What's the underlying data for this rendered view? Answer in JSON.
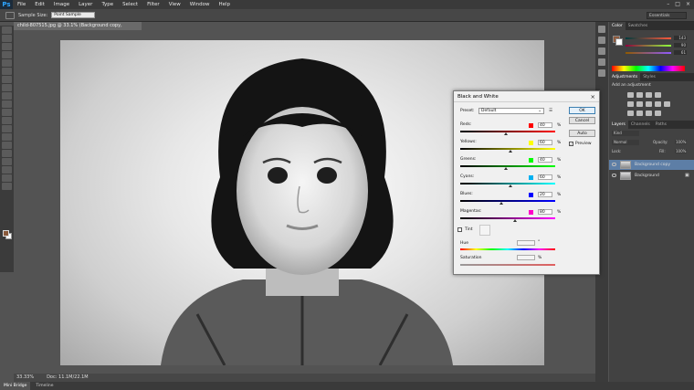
{
  "app": {
    "logo": "Ps"
  },
  "menu": {
    "items": [
      "File",
      "Edit",
      "Image",
      "Layer",
      "Type",
      "Select",
      "Filter",
      "View",
      "Window",
      "Help"
    ]
  },
  "options": {
    "sample_size_label": "Sample Size:",
    "sample_size_value": "Point Sample",
    "workspace": "Essentials"
  },
  "document": {
    "tab_title": "child-807515.jpg @ 33.1% (Background copy, RGB/8#) *",
    "zoom": "33.33%",
    "doc_size": "Doc: 11.1M/22.1M"
  },
  "bottom_tabs": [
    "Mini Bridge",
    "Timeline"
  ],
  "panels": {
    "color_tabs": [
      "Color",
      "Swatches"
    ],
    "color_values": [
      "143",
      "90",
      "61"
    ],
    "adjust_tabs": [
      "Adjustments",
      "Styles"
    ],
    "adjust_label": "Add an adjustment",
    "layers_tabs": [
      "Layers",
      "Channels",
      "Paths"
    ],
    "layers_kind": "Kind",
    "blend_mode": "Normal",
    "opacity_label": "Opacity:",
    "opacity_value": "100%",
    "lock_label": "Lock:",
    "fill_label": "Fill:",
    "fill_value": "100%",
    "layers": [
      "Background copy",
      "Background"
    ]
  },
  "dialog": {
    "title": "Black and White",
    "close": "×",
    "preset_label": "Preset:",
    "preset_value": "Default",
    "ok": "OK",
    "cancel": "Cancel",
    "auto": "Auto",
    "preview": "Preview",
    "preview_check": "✓",
    "percent": "%",
    "sliders": [
      {
        "label": "Reds:",
        "value": "40",
        "color": "#ff0000"
      },
      {
        "label": "Yellows:",
        "value": "60",
        "color": "#ffff00"
      },
      {
        "label": "Greens:",
        "value": "40",
        "color": "#00ff00"
      },
      {
        "label": "Cyans:",
        "value": "60",
        "color": "#00b0f0"
      },
      {
        "label": "Blues:",
        "value": "20",
        "color": "#0000ff"
      },
      {
        "label": "Magentas:",
        "value": "80",
        "color": "#ff00c8"
      }
    ],
    "tint": "Tint",
    "hue": "Hue",
    "hue_unit": "°",
    "saturation": "Saturation"
  }
}
